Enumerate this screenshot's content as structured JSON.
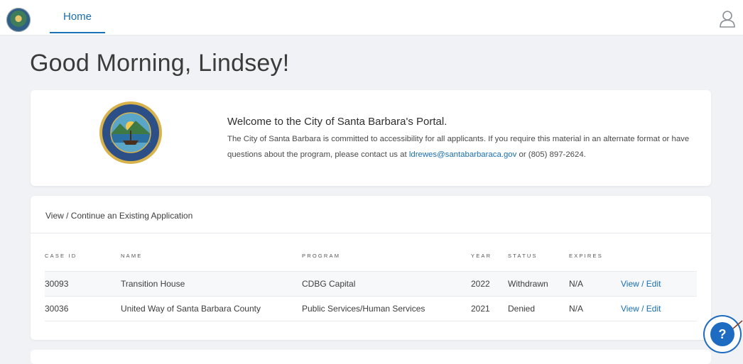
{
  "nav": {
    "home_label": "Home"
  },
  "greeting": "Good Morning, Lindsey!",
  "welcome": {
    "title": "Welcome to the City of Santa Barbara's Portal.",
    "body_before": "The City of Santa Barbara is committed to accessibility for all applicants. If you require this material in an alternate format or have questions about the program, please contact us at ",
    "email": "ldrewes@santabarbaraca.gov",
    "body_after": " or (805) 897-2624."
  },
  "applications": {
    "title": "View / Continue an Existing Application",
    "columns": {
      "case_id": "CASE ID",
      "name": "NAME",
      "program": "PROGRAM",
      "year": "YEAR",
      "status": "STATUS",
      "expires": "EXPIRES"
    },
    "rows": [
      {
        "case_id": "30093",
        "name": "Transition House",
        "program": "CDBG Capital",
        "year": "2022",
        "status": "Withdrawn",
        "expires": "N/A",
        "action": "View / Edit"
      },
      {
        "case_id": "30036",
        "name": "United Way of Santa Barbara County",
        "program": "Public Services/Human Services",
        "year": "2021",
        "status": "Denied",
        "expires": "N/A",
        "action": "View / Edit"
      }
    ]
  },
  "help": {
    "label": "?"
  },
  "colors": {
    "accent": "#1a6fb0",
    "help_button": "#1e6cc2",
    "background": "#f0f2f5"
  },
  "icons": {
    "logo": "city-seal-logo",
    "user": "user-icon",
    "seal": "city-seal-icon",
    "help": "help-icon"
  }
}
